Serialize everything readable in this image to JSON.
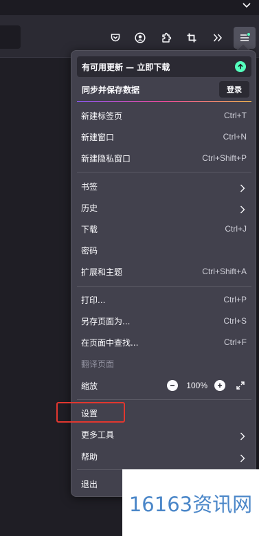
{
  "toolbar": {
    "icons": [
      "pocket-icon",
      "account-icon",
      "extensions-icon",
      "screenshot-icon",
      "overflow-chevron-icon",
      "app-menu-icon"
    ]
  },
  "menu": {
    "update_banner": "有可用更新 — 立即下载",
    "sync_label": "同步并保存数据",
    "signin_label": "登录",
    "items": [
      {
        "label": "新建标签页",
        "shortcut": "Ctrl+T"
      },
      {
        "label": "新建窗口",
        "shortcut": "Ctrl+N"
      },
      {
        "label": "新建隐私窗口",
        "shortcut": "Ctrl+Shift+P"
      },
      {
        "label": "书签",
        "shortcut": ""
      },
      {
        "label": "历史",
        "shortcut": ""
      },
      {
        "label": "下载",
        "shortcut": "Ctrl+J"
      },
      {
        "label": "密码",
        "shortcut": ""
      },
      {
        "label": "扩展和主题",
        "shortcut": "Ctrl+Shift+A"
      },
      {
        "label": "打印...",
        "shortcut": "Ctrl+P"
      },
      {
        "label": "另存页面为...",
        "shortcut": "Ctrl+S"
      },
      {
        "label": "在页面中查找...",
        "shortcut": "Ctrl+F"
      },
      {
        "label": "翻译页面",
        "shortcut": ""
      },
      {
        "label": "缩放",
        "shortcut": ""
      },
      {
        "label": "设置",
        "shortcut": ""
      },
      {
        "label": "更多工具",
        "shortcut": ""
      },
      {
        "label": "帮助",
        "shortcut": ""
      },
      {
        "label": "退出",
        "shortcut": ""
      }
    ],
    "zoom_value": "100%"
  },
  "watermark": "16163资讯网",
  "colors": {
    "panel_bg": "#42414d",
    "toolbar_bg": "#2b2a33",
    "highlight_box": "#e2372f",
    "update_icon": "#54ffbd",
    "watermark_text": "#4a86c8"
  }
}
